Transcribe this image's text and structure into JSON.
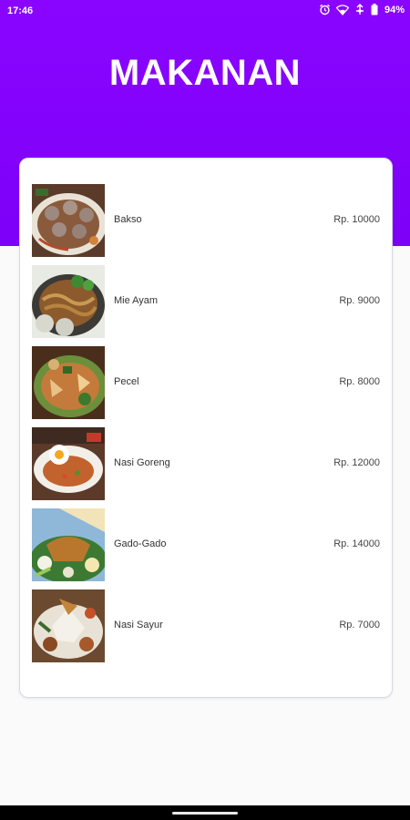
{
  "status_bar": {
    "time": "17:46",
    "battery": "94%",
    "icons": [
      "alarm-icon",
      "wifi-icon",
      "data-icon",
      "battery-icon"
    ]
  },
  "header": {
    "title": "MAKANAN",
    "color": "#8a05ff"
  },
  "menu": {
    "items": [
      {
        "name": "Bakso",
        "price": "Rp. 10000"
      },
      {
        "name": "Mie Ayam",
        "price": "Rp. 9000"
      },
      {
        "name": "Pecel",
        "price": "Rp. 8000"
      },
      {
        "name": "Nasi Goreng",
        "price": "Rp. 12000"
      },
      {
        "name": "Gado-Gado",
        "price": "Rp. 14000"
      },
      {
        "name": "Nasi Sayur",
        "price": "Rp. 7000"
      }
    ]
  }
}
